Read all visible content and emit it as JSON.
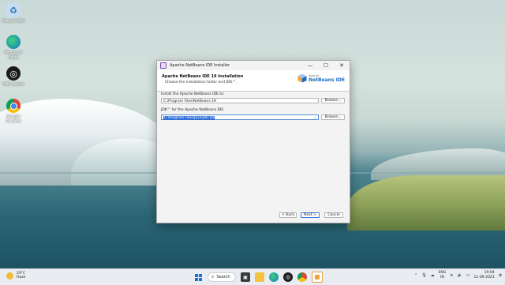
{
  "desktop": {
    "icons": [
      {
        "label": "Recycle Bin",
        "icon": "recycle-bin-icon"
      },
      {
        "label": "Microsoft Edge",
        "icon": "edge-icon"
      },
      {
        "label": "OBS Studio",
        "icon": "obs-icon"
      },
      {
        "label": "Google Chrome",
        "icon": "chrome-icon"
      }
    ]
  },
  "dialog": {
    "window_title": "Apache NetBeans IDE Installer",
    "header_title": "Apache NetBeans IDE 19 Installation",
    "header_subtitle": "Choose the installation folder and JDK™.",
    "logo_small": "Apache",
    "logo_big": "NetBeans IDE",
    "install_label": "Install the Apache NetBeans IDE to:",
    "install_path": "C:\\Program Files\\NetBeans-19",
    "browse_label": "Browse...",
    "jdk_label": "JDK™ for the Apache NetBeans IDE:",
    "jdk_path": "C:\\Program Files\\Java\\jdk-20",
    "back_label": "< Back",
    "next_label": "Next >",
    "cancel_label": "Cancel",
    "controls": {
      "minimize": "—",
      "maximize": "☐",
      "close": "✕"
    }
  },
  "taskbar": {
    "weather_temp": "29°C",
    "weather_desc": "Haze",
    "search_label": "Search",
    "lang_top": "ENG",
    "lang_bottom": "IN",
    "time": "19:04",
    "date": "11-09-2023"
  },
  "colors": {
    "accent": "#2f6fd6",
    "taskbar_bg": "#e9edf1"
  }
}
